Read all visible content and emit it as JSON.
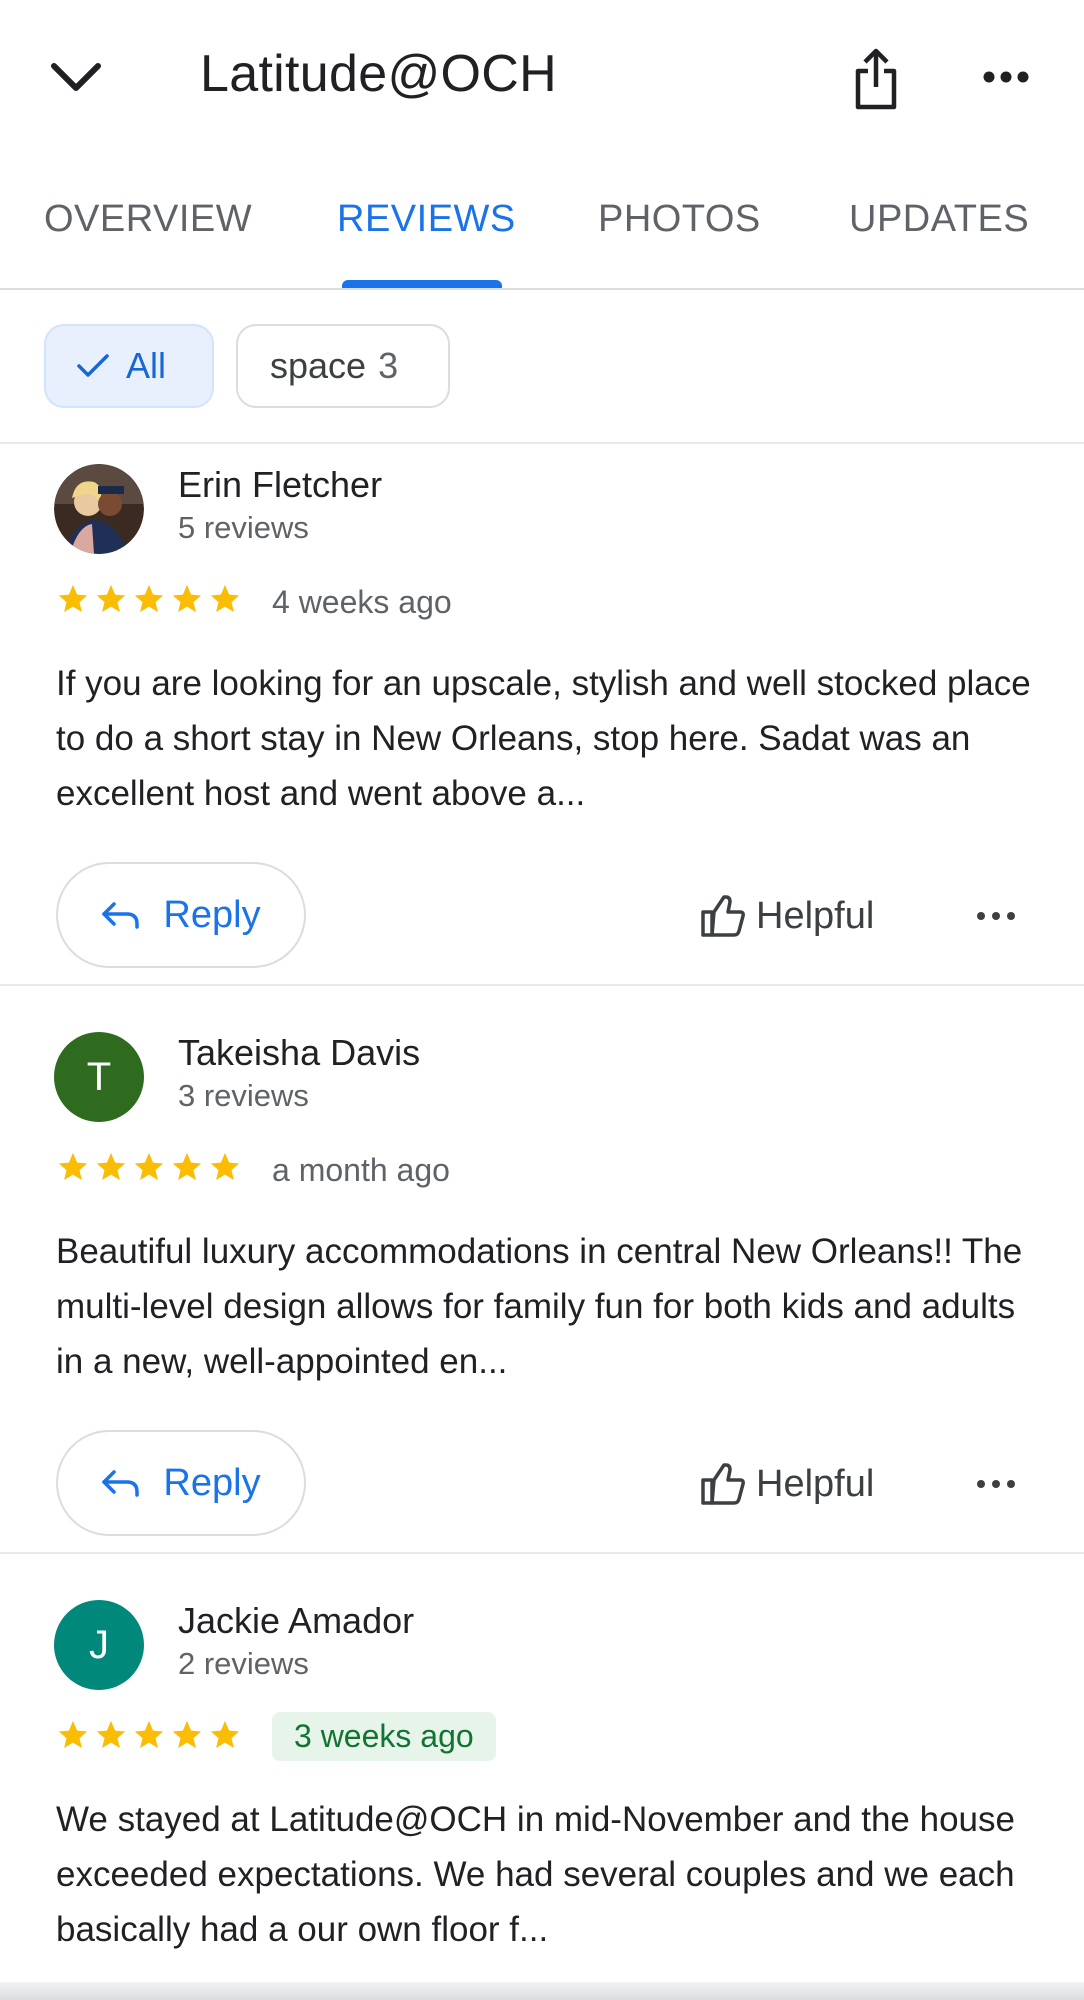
{
  "header": {
    "title": "Latitude@OCH",
    "back_icon": "chevron-down-icon",
    "share_icon": "share-icon",
    "more_icon": "more-horiz-icon"
  },
  "tabs": [
    {
      "label": "OVERVIEW",
      "active": false
    },
    {
      "label": "REVIEWS",
      "active": true
    },
    {
      "label": "PHOTOS",
      "active": false
    },
    {
      "label": "UPDATES",
      "active": false
    }
  ],
  "filters": {
    "all_label": "All",
    "topic_label": "space",
    "topic_count": "3"
  },
  "colors": {
    "accent": "#1a73e8",
    "star": "#fbbc04",
    "avatar_green_dark": "#2e6b1f",
    "avatar_teal": "#00897b",
    "new_badge_bg": "#e6f4ea"
  },
  "reviews": [
    {
      "name": "Erin Fletcher",
      "review_count": "5 reviews",
      "rating": 5,
      "date": "4 weeks ago",
      "text": "If you are looking for an upscale, stylish and well stocked place to do a short stay in New Orleans, stop here. Sadat was an excellent host and went above a...",
      "avatar_initial": "",
      "reply_label": "Reply",
      "helpful_label": "Helpful"
    },
    {
      "name": "Takeisha Davis",
      "review_count": "3 reviews",
      "rating": 5,
      "date": "a month ago",
      "text": "Beautiful luxury accommodations in central New Orleans!! The multi-level design allows for family fun for both kids and adults in a new, well-appointed en...",
      "avatar_initial": "T",
      "reply_label": "Reply",
      "helpful_label": "Helpful"
    },
    {
      "name": "Jackie Amador",
      "review_count": "2 reviews",
      "rating": 5,
      "date": "3 weeks ago",
      "text": "We stayed at Latitude@OCH in mid-November and the house exceeded expectations.  We had several couples and we each basically had a our own floor f...",
      "avatar_initial": "J"
    }
  ]
}
